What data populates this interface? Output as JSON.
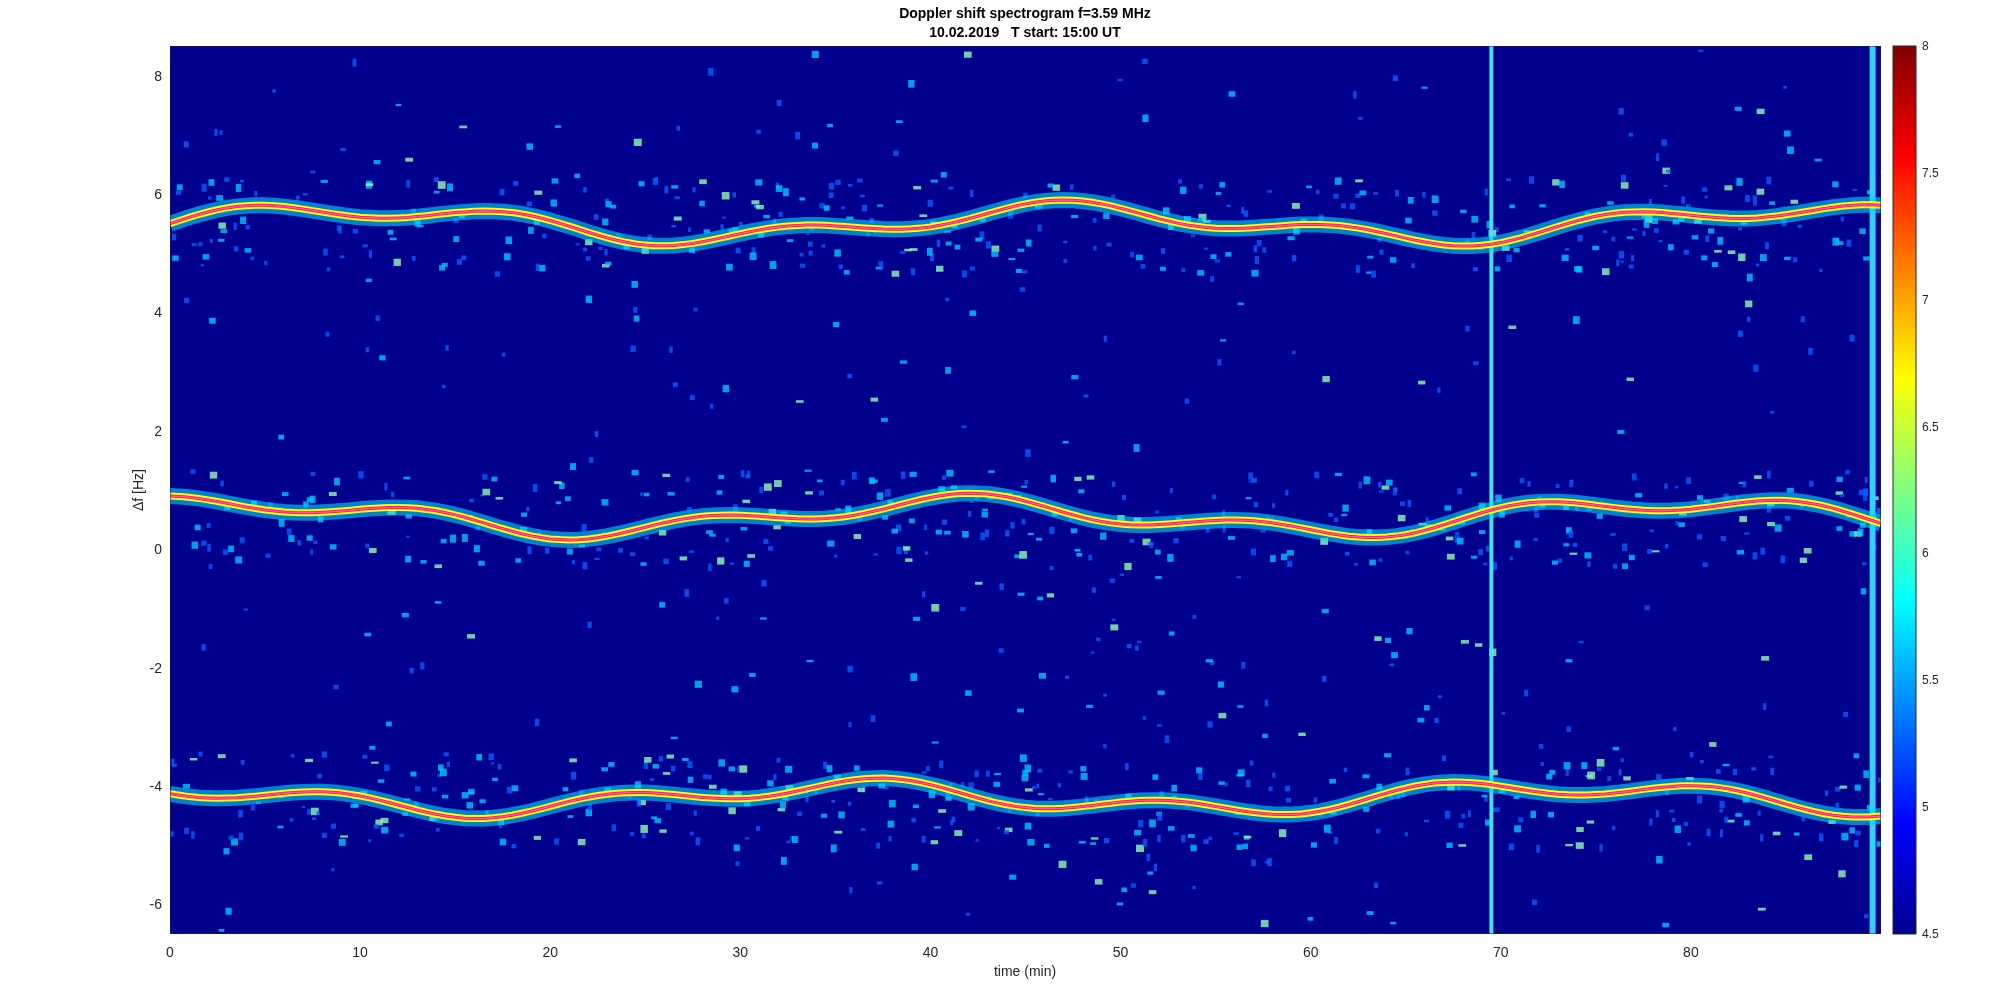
{
  "figure": {
    "title": "Doppler shift spectrogram f=3.59 MHz",
    "subtitle": "10.02.2019   T start: 15:00 UT",
    "xlabel": "time (min)",
    "ylabel": "Δf [Hz]",
    "xticks": [
      "0",
      "10",
      "20",
      "30",
      "40",
      "50",
      "60",
      "70",
      "80"
    ],
    "yticks": [
      "8",
      "6",
      "4",
      "2",
      "0",
      "-2",
      "-4",
      "-6"
    ],
    "colorbar_ticks": [
      "8",
      "7.5",
      "7",
      "6.5",
      "6",
      "5.5",
      "5",
      "4.5"
    ]
  }
}
